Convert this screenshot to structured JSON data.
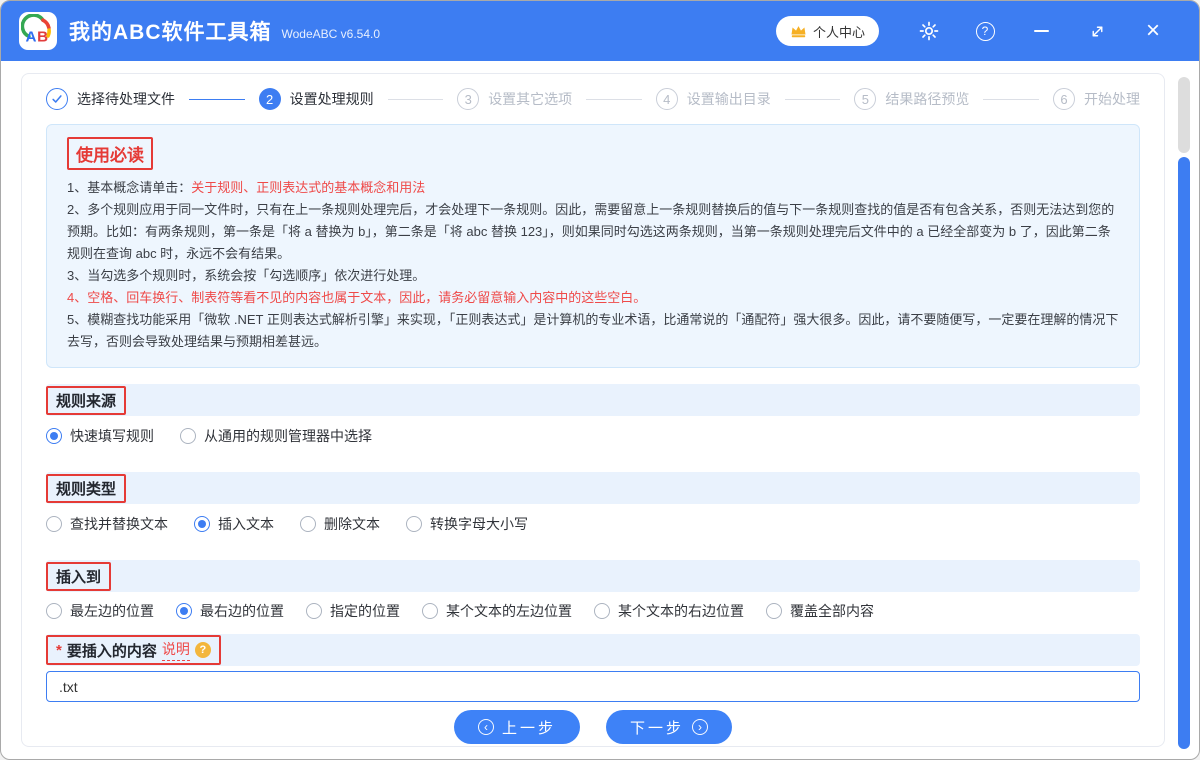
{
  "titlebar": {
    "logo_text": "AB",
    "title": "我的ABC软件工具箱",
    "version": "WodeABC v6.54.0",
    "user_center_label": "个人中心",
    "accent_color": "#3d7df2"
  },
  "stepper": {
    "steps": [
      {
        "num": "1",
        "label": "选择待处理文件",
        "state": "done"
      },
      {
        "num": "2",
        "label": "设置处理规则",
        "state": "active"
      },
      {
        "num": "3",
        "label": "设置其它选项",
        "state": "todo"
      },
      {
        "num": "4",
        "label": "设置输出目录",
        "state": "todo"
      },
      {
        "num": "5",
        "label": "结果路径预览",
        "state": "todo"
      },
      {
        "num": "6",
        "label": "开始处理",
        "state": "todo"
      }
    ]
  },
  "notice": {
    "title": "使用必读",
    "item1_prefix": "1、基本概念请单击：",
    "item1_link": "关于规则、正则表达式的基本概念和用法",
    "item2": "2、多个规则应用于同一文件时，只有在上一条规则处理完后，才会处理下一条规则。因此，需要留意上一条规则替换后的值与下一条规则查找的值是否有包含关系，否则无法达到您的预期。比如：有两条规则，第一条是「将 a 替换为 b」，第二条是「将 abc 替换 123」，则如果同时勾选这两条规则，当第一条规则处理完后文件中的 a 已经全部变为 b 了，因此第二条规则在查询 abc 时，永远不会有结果。",
    "item3": "3、当勾选多个规则时，系统会按「勾选顺序」依次进行处理。",
    "item4": "4、空格、回车换行、制表符等看不见的内容也属于文本，因此，请务必留意输入内容中的这些空白。",
    "item5": "5、模糊查找功能采用「微软 .NET 正则表达式解析引擎」来实现，「正则表达式」是计算机的专业术语，比通常说的「通配符」强大很多。因此，请不要随便写，一定要在理解的情况下去写，否则会导致处理结果与预期相差甚远。"
  },
  "rule_source": {
    "heading": "规则来源",
    "options": [
      {
        "label": "快速填写规则",
        "selected": true
      },
      {
        "label": "从通用的规则管理器中选择",
        "selected": false
      }
    ]
  },
  "rule_type": {
    "heading": "规则类型",
    "options": [
      {
        "label": "查找并替换文本",
        "selected": false
      },
      {
        "label": "插入文本",
        "selected": true
      },
      {
        "label": "删除文本",
        "selected": false
      },
      {
        "label": "转换字母大小写",
        "selected": false
      }
    ]
  },
  "insert_position": {
    "heading": "插入到",
    "options": [
      {
        "label": "最左边的位置",
        "selected": false
      },
      {
        "label": "最右边的位置",
        "selected": true
      },
      {
        "label": "指定的位置",
        "selected": false
      },
      {
        "label": "某个文本的左边位置",
        "selected": false
      },
      {
        "label": "某个文本的右边位置",
        "selected": false
      },
      {
        "label": "覆盖全部内容",
        "selected": false
      }
    ]
  },
  "insert_content": {
    "required_mark": "*",
    "label": "要插入的内容",
    "help_link": "说明",
    "help_icon": "?",
    "value": ".txt"
  },
  "footer": {
    "prev_label": "上一步",
    "next_label": "下一步",
    "prev_icon": "‹",
    "next_icon": "›"
  }
}
